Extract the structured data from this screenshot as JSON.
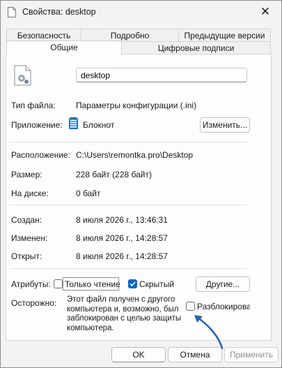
{
  "window": {
    "title": "Свойства: desktop"
  },
  "tabs": {
    "row1": [
      "Безопасность",
      "Подробно",
      "Предыдущие версии"
    ],
    "row2": [
      "Общие",
      "Цифровые подписи"
    ]
  },
  "general": {
    "filename": "desktop",
    "file_type_label": "Тип файла:",
    "file_type_value": "Параметры конфигурации (.ini)",
    "app_label": "Приложение:",
    "app_value": "Блокнот",
    "change_button": "Изменить...",
    "location_label": "Расположение:",
    "location_value": "C:\\Users\\remontka.pro\\Desktop",
    "size_label": "Размер:",
    "size_value": "228 байт (228 байт)",
    "disk_label": "На диске:",
    "disk_value": "0 байт",
    "created_label": "Создан:",
    "created_value": "8 июля 2026 г., 13:46:31",
    "modified_label": "Изменен:",
    "modified_value": "8 июля 2026 г., 14:28:57",
    "opened_label": "Открыт:",
    "opened_value": "8 июля 2026 г., 14:28:57",
    "attributes_label": "Атрибуты:",
    "readonly_label": "Только чтение",
    "readonly_checked": false,
    "hidden_label": "Скрытый",
    "hidden_checked": true,
    "other_button": "Другие...",
    "caution_label": "Осторожно:",
    "caution_text_1": "Этот файл получен с другого",
    "caution_text_2": "компьютера и, возможно, был",
    "caution_text_3": "заблокирован с целью защиты",
    "caution_text_4": "компьютера.",
    "unblock_label": "Разблокировать",
    "unblock_checked": false
  },
  "footer": {
    "ok": "OK",
    "cancel": "Отмена",
    "apply": "Применить"
  },
  "colors": {
    "accent": "#0067c0",
    "arrow": "#2e63a8"
  },
  "icons": [
    "config-file-icon",
    "notepad-icon",
    "close-icon",
    "check-icon",
    "arrow-icon"
  ]
}
